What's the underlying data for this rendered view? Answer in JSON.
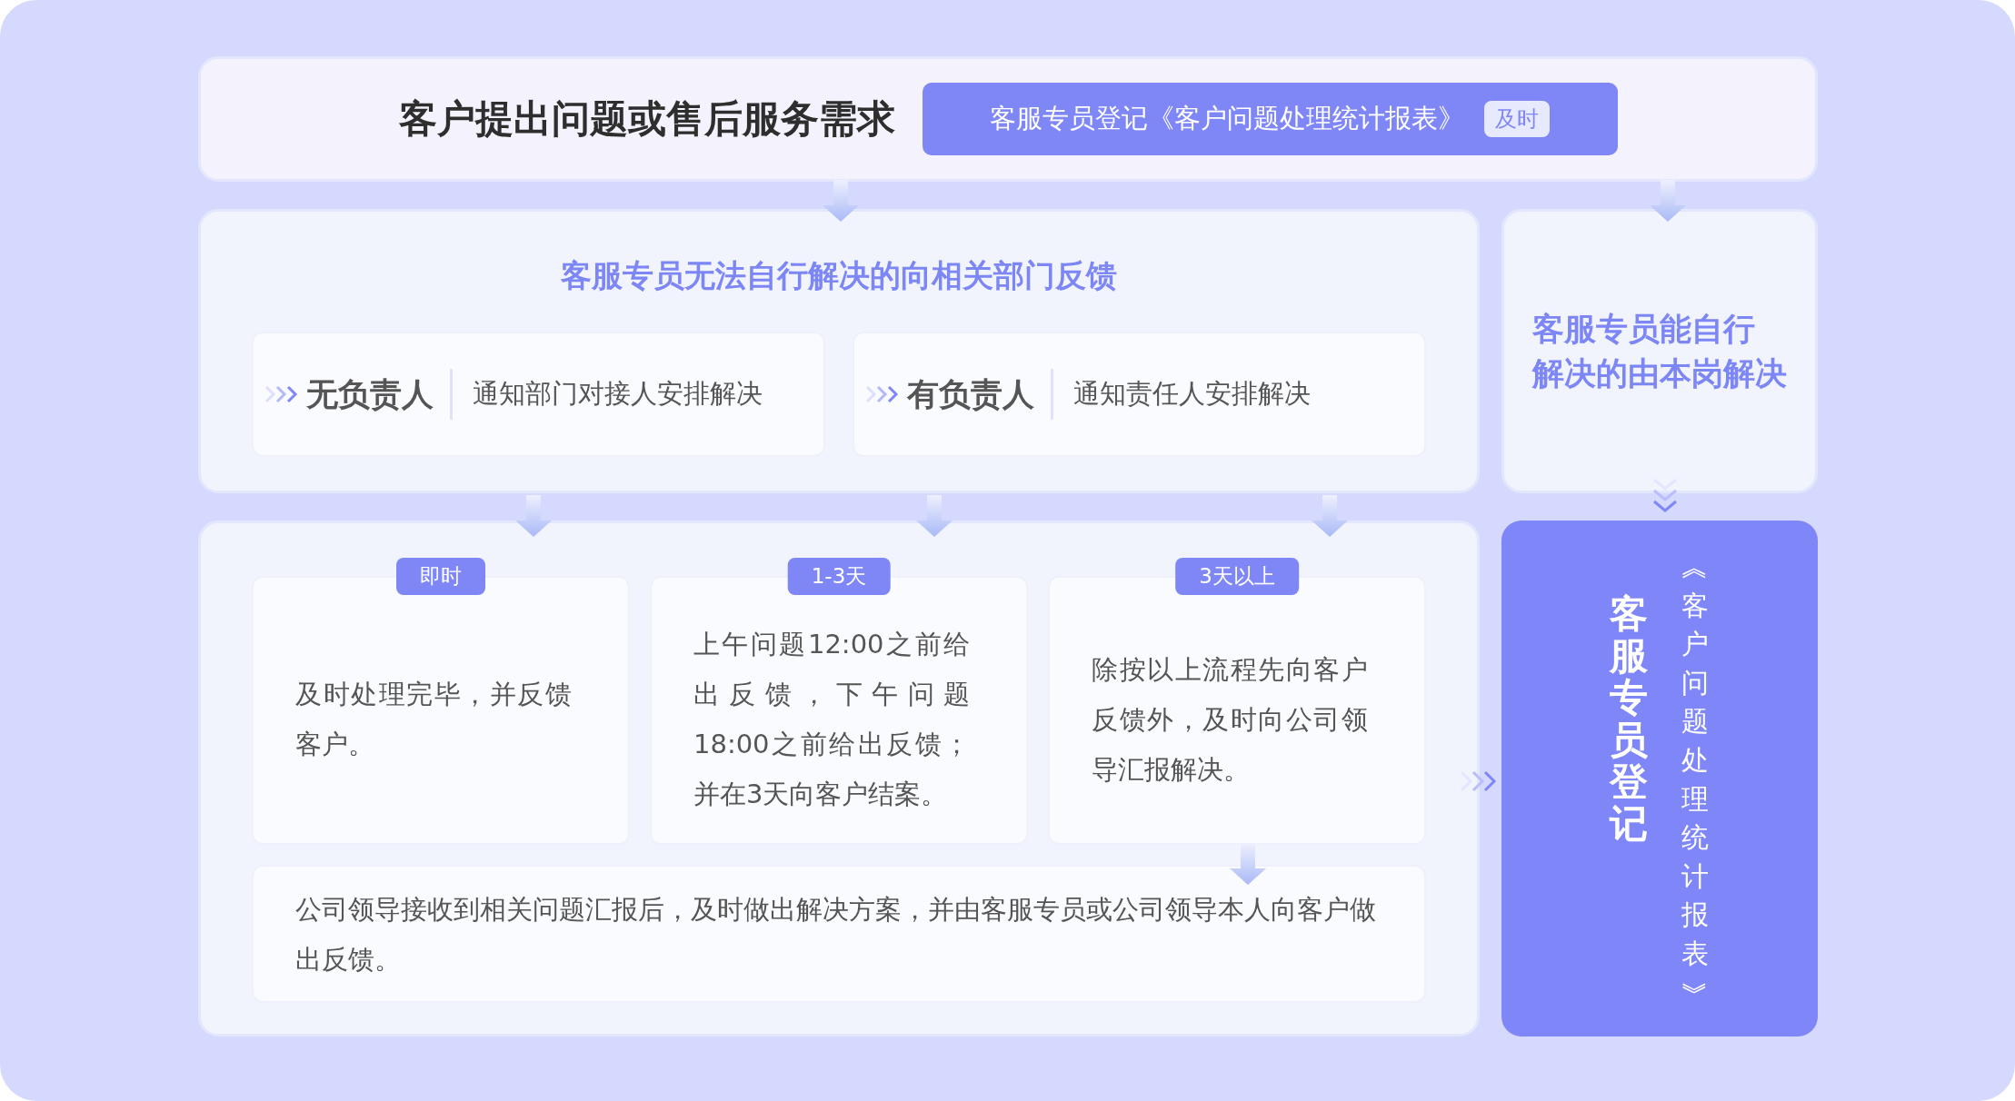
{
  "header": {
    "title": "客户提出问题或售后服务需求",
    "banner": {
      "text": "客服专员登记《客户问题处理统计报表》",
      "tag": "及时"
    }
  },
  "escalation": {
    "title": "客服专员无法自行解决的向相关部门反馈",
    "options": [
      {
        "label": "无负责人",
        "action": "通知部门对接人安排解决"
      },
      {
        "label": "有负责人",
        "action": "通知责任人安排解决"
      }
    ]
  },
  "self_resolve": {
    "lines": [
      "客服专员能自行",
      "解决的由本岗解决"
    ]
  },
  "timeline": [
    {
      "tag": "即时",
      "text": "及时处理完毕，并反馈客户。"
    },
    {
      "tag": "1-3天",
      "text": "上午问题12:00之前给出反馈，下午问题18:00之前给出反馈；并在3天向客户结案。"
    },
    {
      "tag": "3天以上",
      "text": "除按以上流程先向客户反馈外，及时向公司领导汇报解决。"
    }
  ],
  "leader_feedback": "公司领导接收到相关问题汇报后，及时做出解决方案，并由客服专员或公司领导本人向客户做出反馈。",
  "register": {
    "title": "客服专员登记",
    "subtitle": "︽客户问题处理统计报表︾"
  }
}
